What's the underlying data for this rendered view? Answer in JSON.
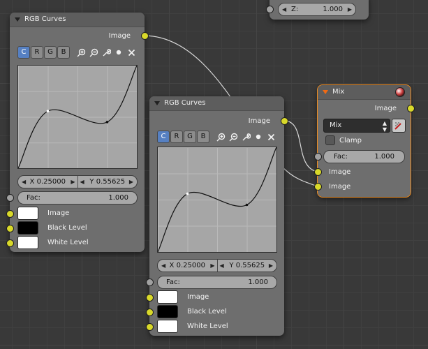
{
  "colors": {
    "socket_color": "#d9d92a",
    "socket_value": "#a1a1a1",
    "active_outline": "#f08c1e",
    "selected_button": "#5680c2"
  },
  "top_node": {
    "field_label": "Z:",
    "field_value": "1.000"
  },
  "curves_node_1": {
    "title": "RGB Curves",
    "output_label": "Image",
    "channel_buttons": [
      "C",
      "R",
      "G",
      "B"
    ],
    "selected_channel": "C",
    "tool_icons": [
      "zoom-in-icon",
      "zoom-out-icon",
      "wrench-icon",
      "dot-icon",
      "close-icon"
    ],
    "point_x": "X 0.25000",
    "point_y": "Y 0.55625",
    "fac_label": "Fac:",
    "fac_value": "1.000",
    "inputs": [
      {
        "label": "Image",
        "swatch": "#ffffff"
      },
      {
        "label": "Black Level",
        "swatch": "#000000"
      },
      {
        "label": "White Level",
        "swatch": "#ffffff"
      }
    ],
    "curve_points": [
      [
        0,
        0
      ],
      [
        0.25,
        0.55625
      ],
      [
        0.75,
        0.45
      ],
      [
        1,
        1
      ]
    ]
  },
  "curves_node_2": {
    "title": "RGB Curves",
    "output_label": "Image",
    "channel_buttons": [
      "C",
      "R",
      "G",
      "B"
    ],
    "selected_channel": "C",
    "tool_icons": [
      "zoom-in-icon",
      "zoom-out-icon",
      "wrench-icon",
      "dot-icon",
      "close-icon"
    ],
    "point_x": "X 0.25000",
    "point_y": "Y 0.55625",
    "fac_label": "Fac:",
    "fac_value": "1.000",
    "inputs": [
      {
        "label": "Image",
        "swatch": "#ffffff"
      },
      {
        "label": "Black Level",
        "swatch": "#000000"
      },
      {
        "label": "White Level",
        "swatch": "#ffffff"
      }
    ],
    "curve_points": [
      [
        0,
        0
      ],
      [
        0.25,
        0.55625
      ],
      [
        0.75,
        0.45
      ],
      [
        1,
        1
      ]
    ]
  },
  "mix_node": {
    "title": "Mix",
    "output_label": "Image",
    "blend_mode": "Mix",
    "clamp_label": "Clamp",
    "fac_label": "Fac:",
    "fac_value": "1.000",
    "input_1": "Image",
    "input_2": "Image"
  }
}
